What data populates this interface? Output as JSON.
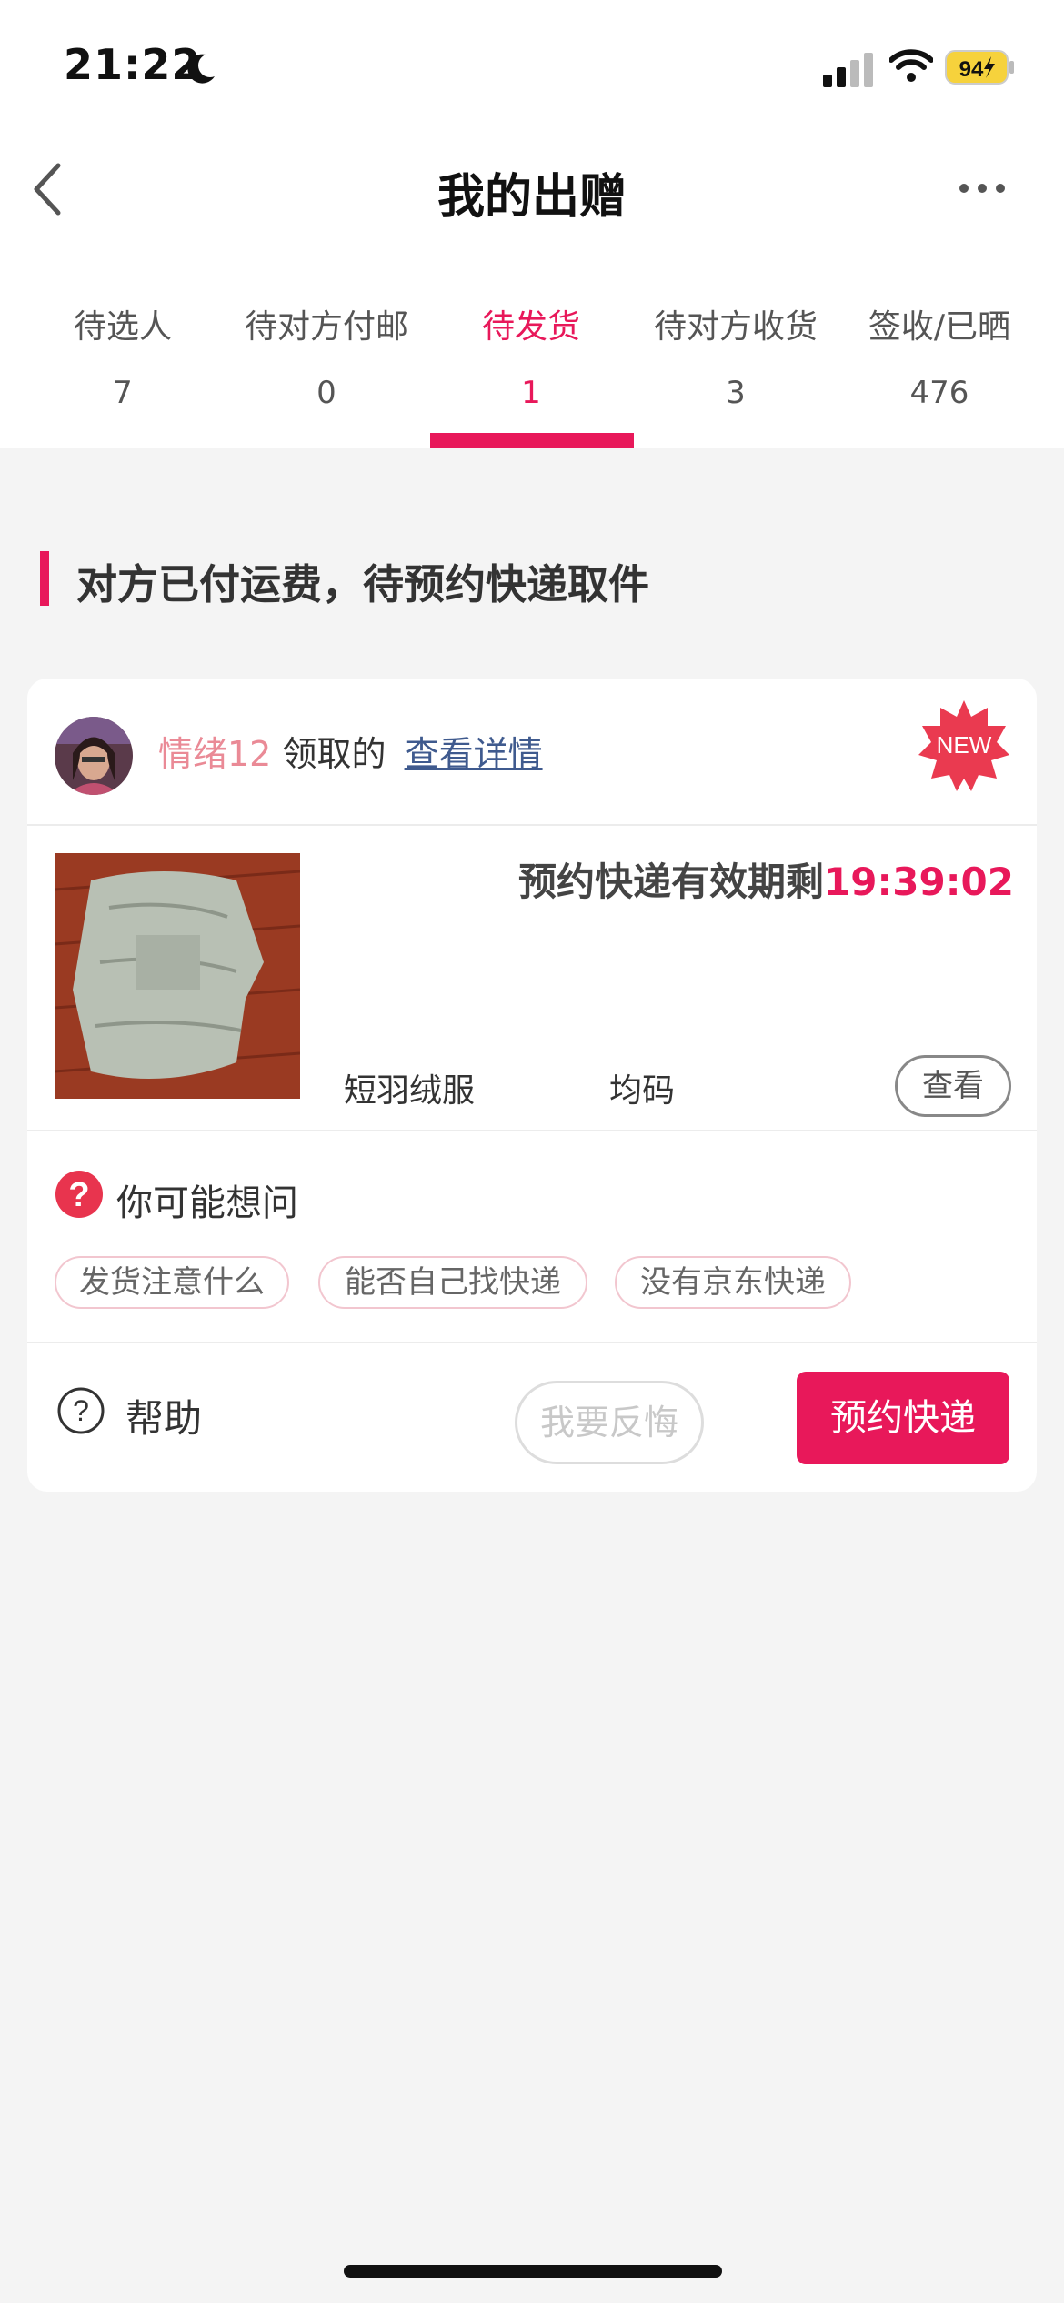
{
  "status_bar": {
    "time": "21:22",
    "battery": "94"
  },
  "header": {
    "title": "我的出赠"
  },
  "tabs": [
    {
      "label": "待选人",
      "count": "7"
    },
    {
      "label": "待对方付邮",
      "count": "0"
    },
    {
      "label": "待发货",
      "count": "1"
    },
    {
      "label": "待对方收货",
      "count": "3"
    },
    {
      "label": "签收/已晒",
      "count": "476"
    }
  ],
  "active_tab": "待发货",
  "section": {
    "title": "对方已付运费，待预约快递取件"
  },
  "card": {
    "username": "情绪12",
    "claimed_text": "领取的",
    "detail_link": "查看详情",
    "badge": "NEW",
    "timer_label": "预约快递有效期剩",
    "timer_value": "19:39:02",
    "product_name": "短羽绒服",
    "product_size": "均码",
    "view_button": "查看",
    "faq_title": "你可能想问",
    "faq_chips": [
      "发货注意什么",
      "能否自己找快递",
      "没有京东快递"
    ],
    "help_label": "帮助",
    "regret_button": "我要反悔",
    "book_button": "预约快递"
  },
  "colors": {
    "accent": "#e8185a",
    "username": "#ea8a96",
    "link": "#3f5a8e",
    "background": "#f4f4f4"
  }
}
